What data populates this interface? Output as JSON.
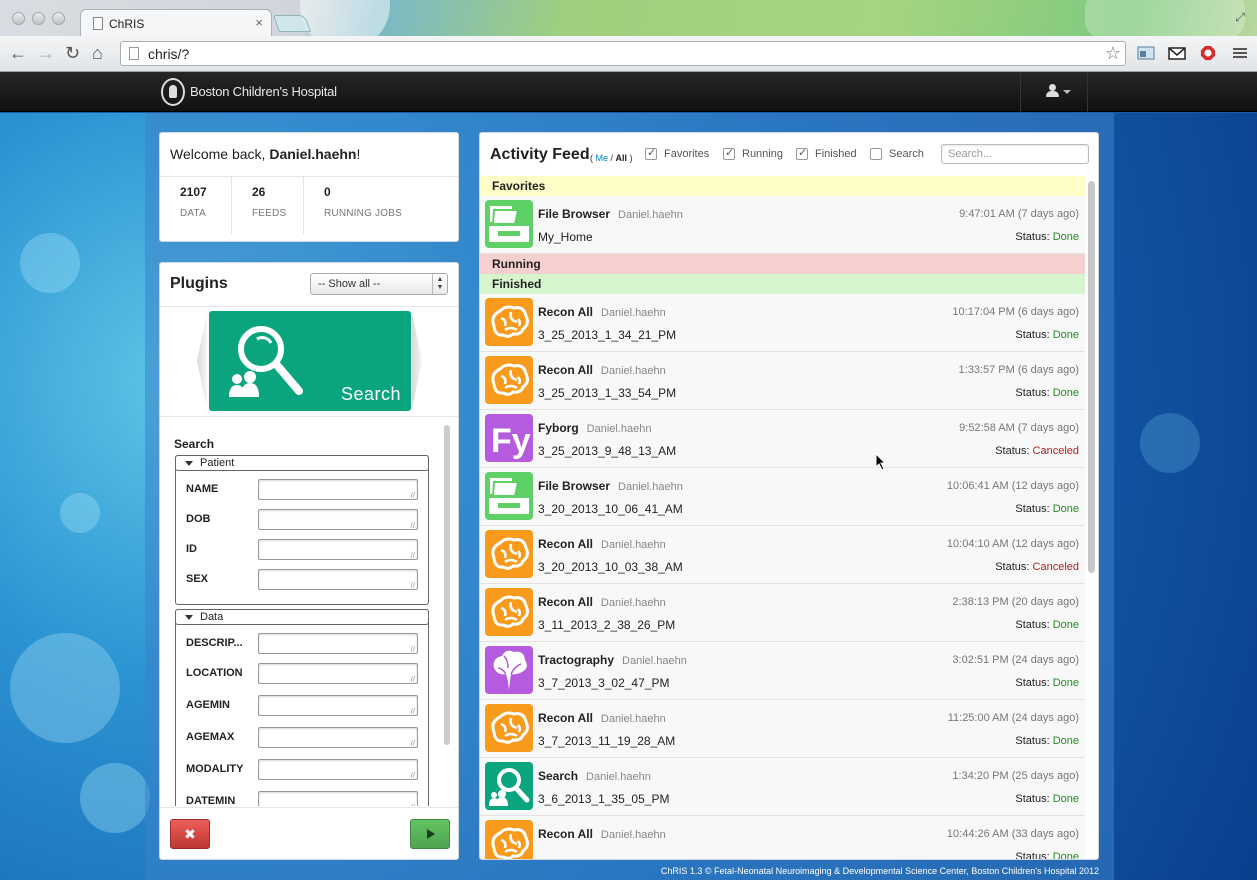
{
  "browser": {
    "tab_title": "ChRIS",
    "tab_close": "×",
    "url": "chris/?",
    "nav": {
      "back": "←",
      "forward": "→",
      "reload": "↻",
      "home": "⌂",
      "star": "☆"
    }
  },
  "app": {
    "brand": "Boston Children's Hospital",
    "user_menu_icon": "user-icon"
  },
  "welcome": {
    "prefix": "Welcome back, ",
    "user": "Daniel.haehn",
    "suffix": "!",
    "stats": [
      {
        "value": "2107",
        "label": "DATA"
      },
      {
        "value": "26",
        "label": "FEEDS"
      },
      {
        "value": "0",
        "label": "RUNNING JOBS"
      }
    ]
  },
  "plugins": {
    "title": "Plugins",
    "filter": "-- Show all --",
    "active_plugin": "Search",
    "form": {
      "heading": "Search",
      "patient_legend": "Patient",
      "patient_fields": [
        "NAME",
        "DOB",
        "ID",
        "SEX"
      ],
      "data_legend": "Data",
      "data_fields": [
        "DESCRIP...",
        "LOCATION",
        "AGEMIN",
        "AGEMAX",
        "MODALITY",
        "DATEMIN"
      ]
    },
    "cancel_icon": "✖",
    "run_icon": "play-icon"
  },
  "feed": {
    "title": "Activity Feed",
    "scope_open": "(",
    "scope_me": "Me",
    "scope_sep": " / ",
    "scope_all": "All",
    "scope_close": ")",
    "filters": [
      {
        "label": "Favorites",
        "checked": true
      },
      {
        "label": "Running",
        "checked": true
      },
      {
        "label": "Finished",
        "checked": true
      },
      {
        "label": "Search",
        "checked": false
      }
    ],
    "search_placeholder": "Search...",
    "sections": {
      "favorites": "Favorites",
      "running": "Running",
      "finished": "Finished"
    },
    "status_prefix": "Status: ",
    "favorites": [
      {
        "plugin": "File Browser",
        "user": "Daniel.haehn",
        "name": "My_Home",
        "time": "9:47:01 AM (7 days ago)",
        "status": "Done",
        "icon": "file-browser-icon",
        "color": "green"
      }
    ],
    "finished": [
      {
        "plugin": "Recon All",
        "user": "Daniel.haehn",
        "name": "3_25_2013_1_34_21_PM",
        "time": "10:17:04 PM (6 days ago)",
        "status": "Done",
        "icon": "brain-icon",
        "color": "orange"
      },
      {
        "plugin": "Recon All",
        "user": "Daniel.haehn",
        "name": "3_25_2013_1_33_54_PM",
        "time": "1:33:57 PM (6 days ago)",
        "status": "Done",
        "icon": "brain-icon",
        "color": "orange"
      },
      {
        "plugin": "Fyborg",
        "user": "Daniel.haehn",
        "name": "3_25_2013_9_48_13_AM",
        "time": "9:52:58 AM (7 days ago)",
        "status": "Canceled",
        "icon": "fyborg-icon",
        "color": "purple"
      },
      {
        "plugin": "File Browser",
        "user": "Daniel.haehn",
        "name": "3_20_2013_10_06_41_AM",
        "time": "10:06:41 AM (12 days ago)",
        "status": "Done",
        "icon": "file-browser-icon",
        "color": "green"
      },
      {
        "plugin": "Recon All",
        "user": "Daniel.haehn",
        "name": "3_20_2013_10_03_38_AM",
        "time": "10:04:10 AM (12 days ago)",
        "status": "Canceled",
        "icon": "brain-icon",
        "color": "orange"
      },
      {
        "plugin": "Recon All",
        "user": "Daniel.haehn",
        "name": "3_11_2013_2_38_26_PM",
        "time": "2:38:13 PM (20 days ago)",
        "status": "Done",
        "icon": "brain-icon",
        "color": "orange"
      },
      {
        "plugin": "Tractography",
        "user": "Daniel.haehn",
        "name": "3_7_2013_3_02_47_PM",
        "time": "3:02:51 PM (24 days ago)",
        "status": "Done",
        "icon": "tractography-icon",
        "color": "purple"
      },
      {
        "plugin": "Recon All",
        "user": "Daniel.haehn",
        "name": "3_7_2013_11_19_28_AM",
        "time": "11:25:00 AM (24 days ago)",
        "status": "Done",
        "icon": "brain-icon",
        "color": "orange"
      },
      {
        "plugin": "Search",
        "user": "Daniel.haehn",
        "name": "3_6_2013_1_35_05_PM",
        "time": "1:34:20 PM (25 days ago)",
        "status": "Done",
        "icon": "search-icon",
        "color": "teal"
      },
      {
        "plugin": "Recon All",
        "user": "Daniel.haehn",
        "name": "",
        "time": "10:44:26 AM (33 days ago)",
        "status": "Done",
        "icon": "brain-icon",
        "color": "orange"
      }
    ]
  },
  "footer": "ChRIS 1.3 © Fetal-Neonatal Neuroimaging & Developmental Science Center, Boston Children's Hospital 2012"
}
